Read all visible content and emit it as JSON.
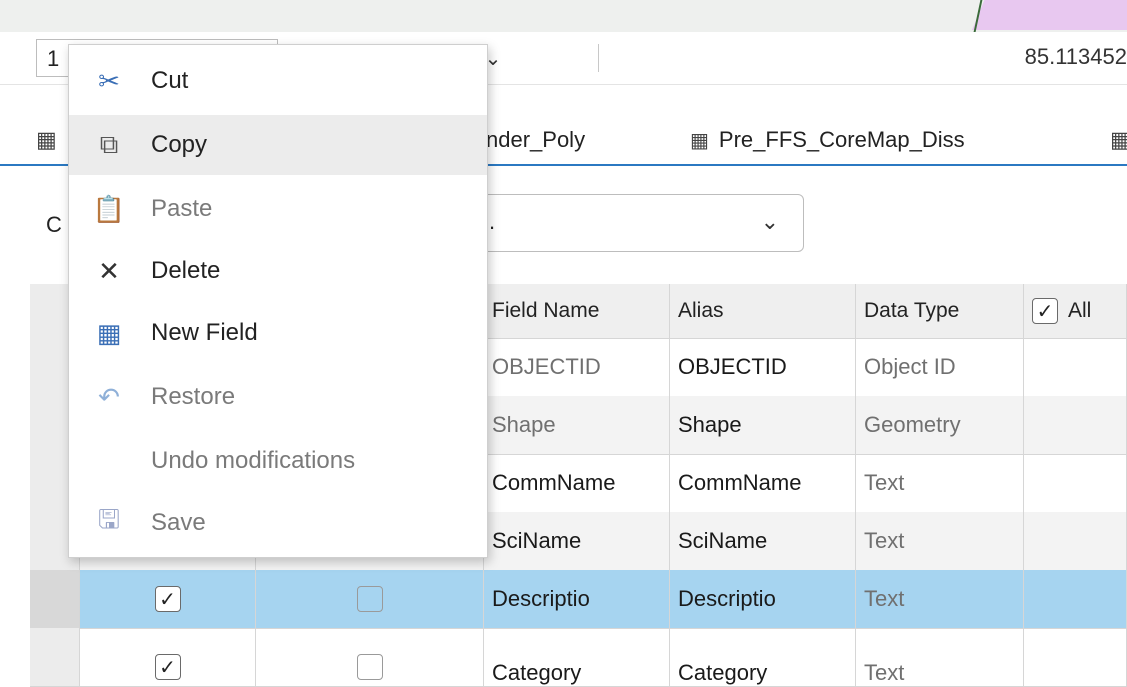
{
  "toolbar": {
    "field_value": "1",
    "coord_readout": "85.113452"
  },
  "tabs": [
    {
      "label": "nder_Poly"
    },
    {
      "label": "Pre_FFS_CoreMap_Diss"
    }
  ],
  "filter": {
    "prefix": "C",
    "combo_value": "."
  },
  "grid": {
    "headers": {
      "field_name": "Field Name",
      "alias": "Alias",
      "data_type": "Data Type",
      "all": "All"
    },
    "rows": [
      {
        "field_name": "OBJECTID",
        "alias": "OBJECTID",
        "data_type": "Object ID"
      },
      {
        "field_name": "Shape",
        "alias": "Shape",
        "data_type": "Geometry"
      },
      {
        "field_name": "CommName",
        "alias": "CommName",
        "data_type": "Text"
      },
      {
        "field_name": "SciName",
        "alias": "SciName",
        "data_type": "Text"
      },
      {
        "field_name": "Descriptio",
        "alias": "Descriptio",
        "data_type": "Text",
        "selected": true
      },
      {
        "field_name": "Category",
        "alias": "Category",
        "data_type": "Text"
      }
    ]
  },
  "context_menu": {
    "items": [
      {
        "label": "Cut",
        "icon": "scissors-icon",
        "enabled": true
      },
      {
        "label": "Copy",
        "icon": "copy-icon",
        "enabled": true,
        "hover": true
      },
      {
        "label": "Paste",
        "icon": "paste-icon",
        "enabled": false
      },
      {
        "label": "Delete",
        "icon": "delete-x-icon",
        "enabled": true
      },
      {
        "label": "New Field",
        "icon": "new-field-icon",
        "enabled": true
      },
      {
        "label": "Restore",
        "icon": "restore-icon",
        "enabled": false
      },
      {
        "label": "Undo modifications",
        "icon": "",
        "enabled": false
      },
      {
        "label": "Save",
        "icon": "save-icon",
        "enabled": false
      }
    ]
  },
  "colors": {
    "accent": "#2b79c2",
    "selected_row": "#a6d4f0"
  }
}
